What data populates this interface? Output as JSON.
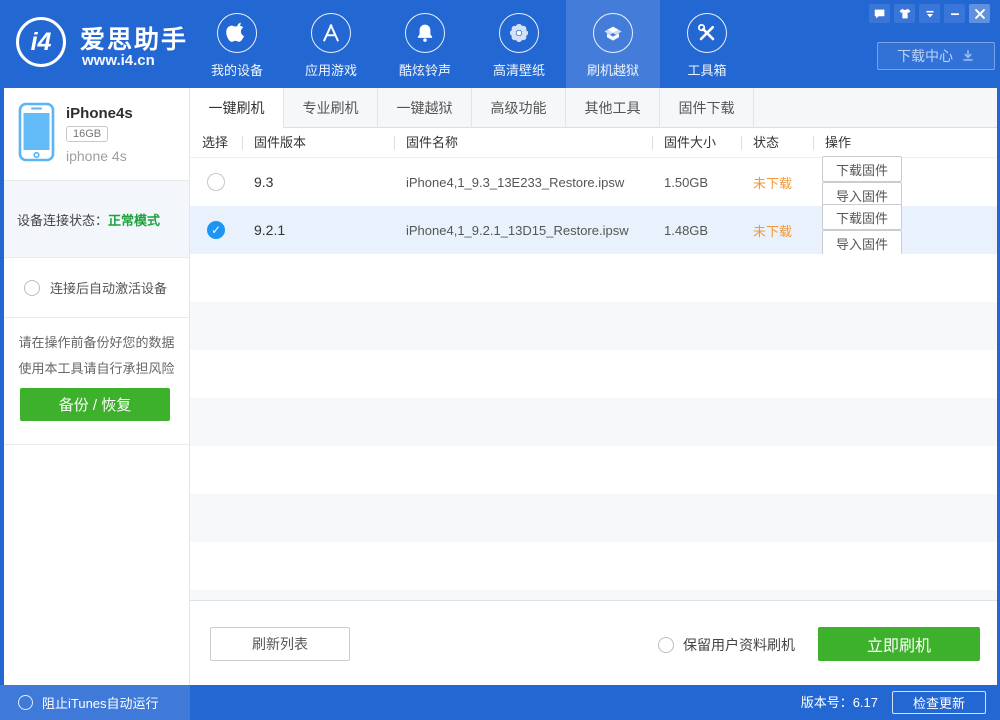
{
  "header": {
    "logo_text": "i4",
    "app_name": "爱思助手",
    "website": "www.i4.cn",
    "download_center": "下载中心",
    "nav": [
      {
        "label": "我的设备",
        "icon": "apple-icon",
        "active": false
      },
      {
        "label": "应用游戏",
        "icon": "appstore-icon",
        "active": false
      },
      {
        "label": "酷炫铃声",
        "icon": "bell-icon",
        "active": false
      },
      {
        "label": "高清壁纸",
        "icon": "flower-icon",
        "active": false
      },
      {
        "label": "刷机越狱",
        "icon": "jailbreak-box-icon",
        "active": true
      },
      {
        "label": "工具箱",
        "icon": "toolbox-icon",
        "active": false
      }
    ],
    "window_controls": [
      "feedback-icon",
      "skin-icon",
      "tray-icon",
      "minimize-icon",
      "close-icon"
    ]
  },
  "sidebar": {
    "device": {
      "name": "iPhone4s",
      "capacity": "16GB",
      "model": "iphone 4s"
    },
    "status_label": "设备连接状态：",
    "status_value": "正常模式",
    "auto_activate_label": "连接后自动激活设备",
    "warning_line1": "请在操作前备份好您的数据",
    "warning_line2": "使用本工具请自行承担风险",
    "backup_button": "备份 / 恢复"
  },
  "tabs": {
    "items": [
      "一键刷机",
      "专业刷机",
      "一键越狱",
      "高级功能",
      "其他工具",
      "固件下载"
    ],
    "active_index": 0
  },
  "table": {
    "columns": [
      "选择",
      "固件版本",
      "固件名称",
      "固件大小",
      "状态",
      "操作"
    ],
    "rows": [
      {
        "selected": false,
        "version": "9.3",
        "name": "iPhone4,1_9.3_13E233_Restore.ipsw",
        "size": "1.50GB",
        "status": "未下载",
        "actions": [
          "下载固件",
          "导入固件"
        ]
      },
      {
        "selected": true,
        "version": "9.2.1",
        "name": "iPhone4,1_9.2.1_13D15_Restore.ipsw",
        "size": "1.48GB",
        "status": "未下载",
        "actions": [
          "下载固件",
          "导入固件"
        ]
      }
    ]
  },
  "action_bar": {
    "refresh_button": "刷新列表",
    "keep_data_label": "保留用户资料刷机",
    "flash_button": "立即刷机"
  },
  "footer": {
    "block_itunes_label": "阻止iTunes自动运行",
    "version_text": "版本号：6.17",
    "check_update_button": "检查更新"
  },
  "colors": {
    "header_blue": "#2367d3",
    "accent_green": "#3eb12c",
    "status_green": "#1fa23e",
    "status_orange": "#ef9a39",
    "checked_radio_blue": "#1e95f2",
    "selected_row_bg": "#e9f2fc"
  }
}
